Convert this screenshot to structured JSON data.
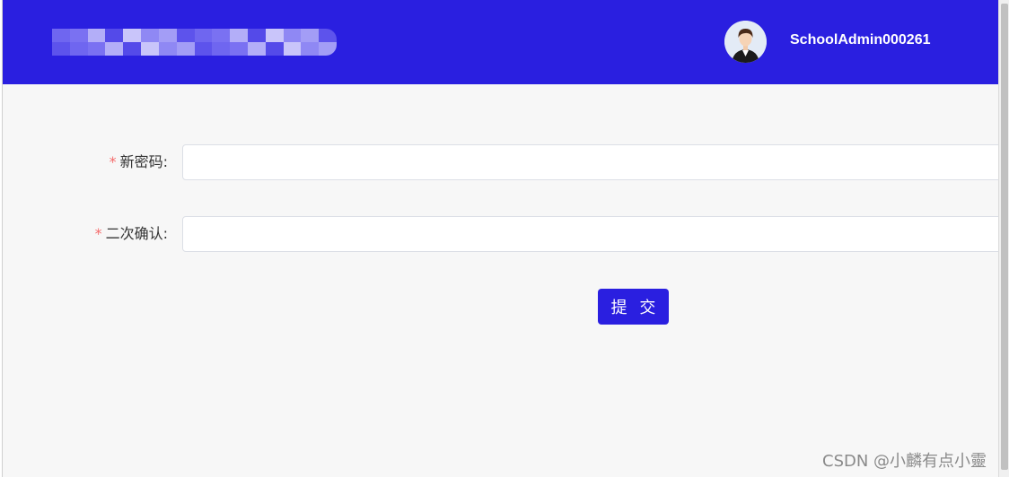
{
  "header": {
    "username": "SchoolAdmin000261",
    "brand_color": "#2a1fe0"
  },
  "form": {
    "fields": [
      {
        "label": "新密码:",
        "required_mark": "*",
        "value": ""
      },
      {
        "label": "二次确认:",
        "required_mark": "*",
        "value": ""
      }
    ],
    "submit_label": "提 交"
  },
  "watermark": "CSDN @小麟有点小靈"
}
